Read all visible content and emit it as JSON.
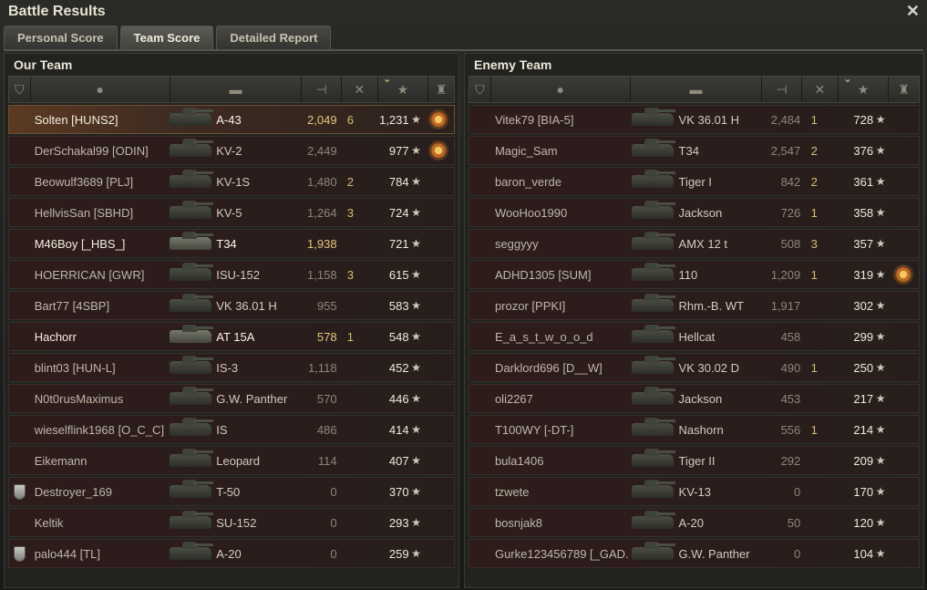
{
  "window": {
    "title": "Battle Results",
    "close_icon": "close-icon"
  },
  "tabs": [
    {
      "label": "Personal Score",
      "active": false
    },
    {
      "label": "Team Score",
      "active": true
    },
    {
      "label": "Detailed Report",
      "active": false
    }
  ],
  "columns": {
    "icons": [
      "platoon-icon",
      "player-icon",
      "vehicle-icon",
      "damage-icon",
      "kills-icon",
      "xp-star-icon",
      "medal-icon"
    ],
    "sorted_by": "xp-star-icon"
  },
  "our_team": {
    "title": "Our Team",
    "rows": [
      {
        "name": "Solten [HUNS2]",
        "vehicle": "A-43",
        "damage": "2,049",
        "kills": "6",
        "xp": "1,231",
        "medal": true,
        "platoon": false,
        "highlight": true
      },
      {
        "name": "DerSchakal99 [ODIN]",
        "vehicle": "KV-2",
        "damage": "2,449",
        "kills": "",
        "xp": "977",
        "medal": true,
        "platoon": false
      },
      {
        "name": "Beowulf3689 [PLJ]",
        "vehicle": "KV-1S",
        "damage": "1,480",
        "kills": "2",
        "xp": "784",
        "medal": false,
        "platoon": false
      },
      {
        "name": "HellvisSan [SBHD]",
        "vehicle": "KV-5",
        "damage": "1,264",
        "kills": "3",
        "xp": "724",
        "medal": false,
        "platoon": false
      },
      {
        "name": "M46Boy [_HBS_]",
        "vehicle": "T34",
        "damage": "1,938",
        "kills": "",
        "xp": "721",
        "medal": false,
        "platoon": false,
        "self": true
      },
      {
        "name": "HOERRICAN [GWR]",
        "vehicle": "ISU-152",
        "damage": "1,158",
        "kills": "3",
        "xp": "615",
        "medal": false,
        "platoon": false
      },
      {
        "name": "Bart77 [4SBP]",
        "vehicle": "VK 36.01 H",
        "damage": "955",
        "kills": "",
        "xp": "583",
        "medal": false,
        "platoon": false
      },
      {
        "name": "Hachorr",
        "vehicle": "AT 15A",
        "damage": "578",
        "kills": "1",
        "xp": "548",
        "medal": false,
        "platoon": false,
        "self": true
      },
      {
        "name": "blint03 [HUN-L]",
        "vehicle": "IS-3",
        "damage": "1,118",
        "kills": "",
        "xp": "452",
        "medal": false,
        "platoon": false
      },
      {
        "name": "N0t0rusMaximus",
        "vehicle": "G.W. Panther",
        "damage": "570",
        "kills": "",
        "xp": "446",
        "medal": false,
        "platoon": false
      },
      {
        "name": "wieselflink1968 [O_C_C]",
        "vehicle": "IS",
        "damage": "486",
        "kills": "",
        "xp": "414",
        "medal": false,
        "platoon": false
      },
      {
        "name": "Eikemann",
        "vehicle": "Leopard",
        "damage": "114",
        "kills": "",
        "xp": "407",
        "medal": false,
        "platoon": false
      },
      {
        "name": "Destroyer_169",
        "vehicle": "T-50",
        "damage": "0",
        "kills": "",
        "xp": "370",
        "medal": false,
        "platoon": true
      },
      {
        "name": "Keltik",
        "vehicle": "SU-152",
        "damage": "0",
        "kills": "",
        "xp": "293",
        "medal": false,
        "platoon": false
      },
      {
        "name": "palo444 [TL]",
        "vehicle": "A-20",
        "damage": "0",
        "kills": "",
        "xp": "259",
        "medal": false,
        "platoon": true
      }
    ]
  },
  "enemy_team": {
    "title": "Enemy Team",
    "rows": [
      {
        "name": "Vitek79 [BIA-5]",
        "vehicle": "VK 36.01 H",
        "damage": "2,484",
        "kills": "1",
        "xp": "728",
        "medal": false,
        "platoon": false
      },
      {
        "name": "Magic_Sam",
        "vehicle": "T34",
        "damage": "2,547",
        "kills": "2",
        "xp": "376",
        "medal": false,
        "platoon": false
      },
      {
        "name": "baron_verde",
        "vehicle": "Tiger I",
        "damage": "842",
        "kills": "2",
        "xp": "361",
        "medal": false,
        "platoon": false
      },
      {
        "name": "WooHoo1990",
        "vehicle": "Jackson",
        "damage": "726",
        "kills": "1",
        "xp": "358",
        "medal": false,
        "platoon": false
      },
      {
        "name": "seggyyy",
        "vehicle": "AMX 12 t",
        "damage": "508",
        "kills": "3",
        "xp": "357",
        "medal": false,
        "platoon": false
      },
      {
        "name": "ADHD1305 [SUM]",
        "vehicle": "110",
        "damage": "1,209",
        "kills": "1",
        "xp": "319",
        "medal": true,
        "platoon": false
      },
      {
        "name": "prozor [PPKI]",
        "vehicle": "Rhm.-B. WT",
        "damage": "1,917",
        "kills": "",
        "xp": "302",
        "medal": false,
        "platoon": false
      },
      {
        "name": "E_a_s_t_w_o_o_d",
        "vehicle": "Hellcat",
        "damage": "458",
        "kills": "",
        "xp": "299",
        "medal": false,
        "platoon": false
      },
      {
        "name": "Darklord696 [D__W]",
        "vehicle": "VK 30.02 D",
        "damage": "490",
        "kills": "1",
        "xp": "250",
        "medal": false,
        "platoon": false
      },
      {
        "name": "oli2267",
        "vehicle": "Jackson",
        "damage": "453",
        "kills": "",
        "xp": "217",
        "medal": false,
        "platoon": false
      },
      {
        "name": "T100WY [-DT-]",
        "vehicle": "Nashorn",
        "damage": "556",
        "kills": "1",
        "xp": "214",
        "medal": false,
        "platoon": false
      },
      {
        "name": "bula1406",
        "vehicle": "Tiger II",
        "damage": "292",
        "kills": "",
        "xp": "209",
        "medal": false,
        "platoon": false
      },
      {
        "name": "tzwete",
        "vehicle": "KV-13",
        "damage": "0",
        "kills": "",
        "xp": "170",
        "medal": false,
        "platoon": false
      },
      {
        "name": "bosnjak8",
        "vehicle": "A-20",
        "damage": "50",
        "kills": "",
        "xp": "120",
        "medal": false,
        "platoon": false
      },
      {
        "name": "Gurke123456789 [_GAD..",
        "vehicle": "G.W. Panther",
        "damage": "0",
        "kills": "",
        "xp": "104",
        "medal": false,
        "platoon": false
      }
    ]
  }
}
